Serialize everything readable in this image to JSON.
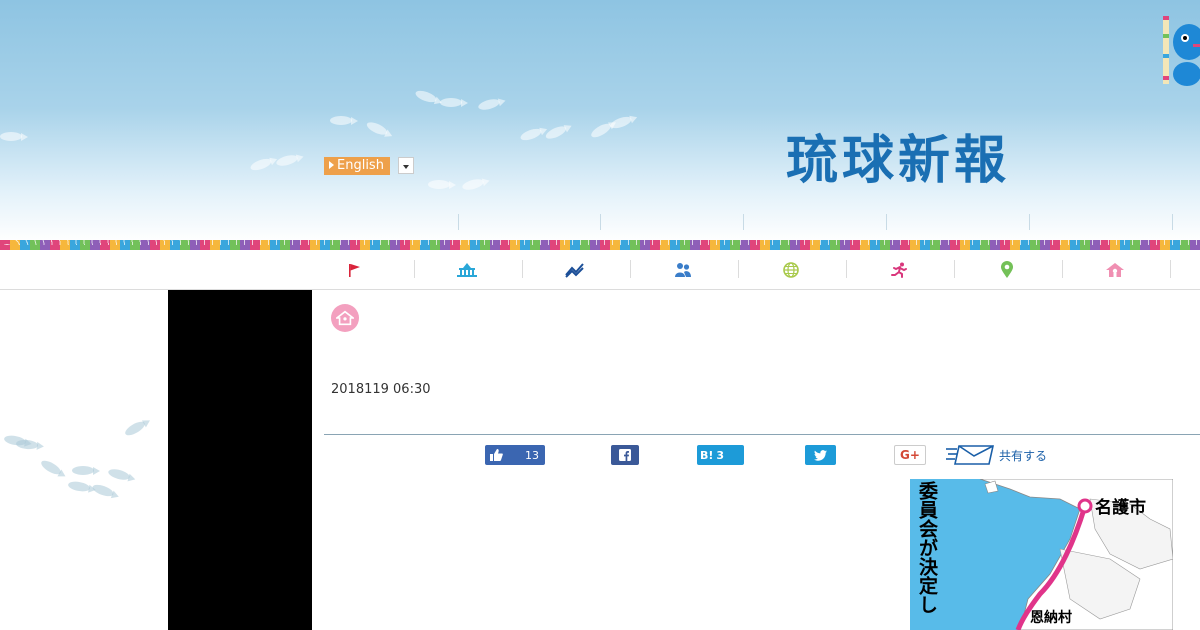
{
  "header": {
    "language_button": "English",
    "logo_text": "琉球新報"
  },
  "category_nav": {
    "items": [
      {
        "icon": "flag-icon",
        "color": "#d9243b"
      },
      {
        "icon": "building-icon",
        "color": "#2aa7d8"
      },
      {
        "icon": "chart-line-icon",
        "color": "#1c4f98"
      },
      {
        "icon": "people-icon",
        "color": "#3a7dc9"
      },
      {
        "icon": "globe-icon",
        "color": "#a8c94a"
      },
      {
        "icon": "runner-icon",
        "color": "#d9377c"
      },
      {
        "icon": "map-pin-icon",
        "color": "#74c158"
      },
      {
        "icon": "home-icon",
        "color": "#f08fb2"
      }
    ]
  },
  "article": {
    "category_icon": "home-icon",
    "date": "2018119 06:30"
  },
  "share": {
    "like_count": "13",
    "hatena_label": "B!",
    "hatena_count": "3",
    "google_label": "G+",
    "share_label": "共有する"
  },
  "map": {
    "vertical_text": "委員会が決定し",
    "label_nago": "名護市",
    "label_onna": "恩納村"
  }
}
